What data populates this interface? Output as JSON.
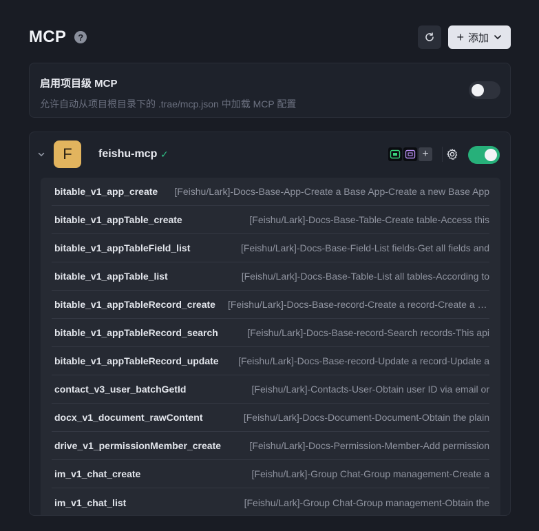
{
  "header": {
    "title": "MCP",
    "help_symbol": "?",
    "add_label": "添加",
    "add_symbol": "+"
  },
  "project": {
    "title": "启用项目级 MCP",
    "description": "允许自动从项目根目录下的 .trae/mcp.json 中加载 MCP 配置",
    "enabled": false
  },
  "server": {
    "avatar_letter": "F",
    "name": "feishu-mcp",
    "status_symbol": "✓",
    "enabled": true,
    "add_tool_symbol": "+",
    "accent_color": "#27b07a",
    "avatar_color": "#e2b45e",
    "tools": [
      {
        "name": "bitable_v1_app_create",
        "description": "[Feishu/Lark]-Docs-Base-App-Create a Base App-Create a new Base App"
      },
      {
        "name": "bitable_v1_appTable_create",
        "description": "[Feishu/Lark]-Docs-Base-Table-Create table-Access this"
      },
      {
        "name": "bitable_v1_appTableField_list",
        "description": "[Feishu/Lark]-Docs-Base-Field-List fields-Get all fields and"
      },
      {
        "name": "bitable_v1_appTable_list",
        "description": "[Feishu/Lark]-Docs-Base-Table-List all tables-According to"
      },
      {
        "name": "bitable_v1_appTableRecord_create",
        "description": "[Feishu/Lark]-Docs-Base-record-Create a record-Create a new"
      },
      {
        "name": "bitable_v1_appTableRecord_search",
        "description": "[Feishu/Lark]-Docs-Base-record-Search records-This api"
      },
      {
        "name": "bitable_v1_appTableRecord_update",
        "description": "[Feishu/Lark]-Docs-Base-record-Update a record-Update a"
      },
      {
        "name": "contact_v3_user_batchGetId",
        "description": "[Feishu/Lark]-Contacts-User-Obtain user ID via email or"
      },
      {
        "name": "docx_v1_document_rawContent",
        "description": "[Feishu/Lark]-Docs-Document-Document-Obtain the plain"
      },
      {
        "name": "drive_v1_permissionMember_create",
        "description": "[Feishu/Lark]-Docs-Permission-Member-Add permission"
      },
      {
        "name": "im_v1_chat_create",
        "description": "[Feishu/Lark]-Group Chat-Group management-Create a"
      },
      {
        "name": "im_v1_chat_list",
        "description": "[Feishu/Lark]-Group Chat-Group management-Obtain the"
      }
    ]
  }
}
